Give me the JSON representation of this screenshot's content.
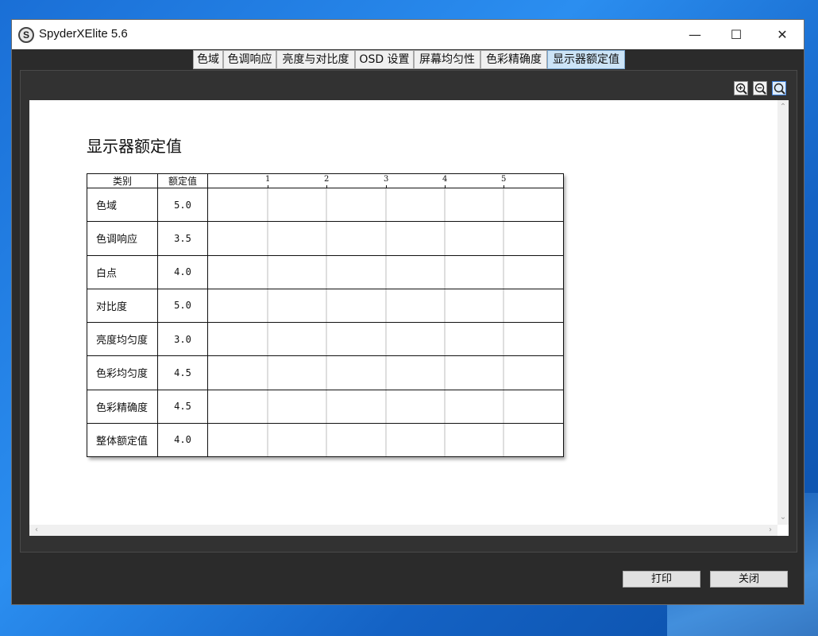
{
  "window": {
    "title": "SpyderXElite 5.6",
    "app_icon_letter": "S",
    "controls": {
      "minimize": "—",
      "maximize": "☐",
      "close": "✕"
    }
  },
  "tabs": [
    {
      "label": "色域",
      "active": false
    },
    {
      "label": "色调响应",
      "active": false
    },
    {
      "label": "亮度与对比度",
      "active": false
    },
    {
      "label": "OSD 设置",
      "active": false
    },
    {
      "label": "屏幕均匀性",
      "active": false
    },
    {
      "label": "色彩精确度",
      "active": false
    },
    {
      "label": "显示器额定值",
      "active": true
    }
  ],
  "zoom_tools": [
    {
      "name": "zoom-in-icon",
      "active": false
    },
    {
      "name": "zoom-out-icon",
      "active": false
    },
    {
      "name": "zoom-fit-icon",
      "active": true
    }
  ],
  "report": {
    "title": "显示器额定值",
    "columns": {
      "category": "类别",
      "rating": "额定值"
    },
    "scale": [
      "1",
      "2",
      "3",
      "4",
      "5"
    ],
    "rows": [
      {
        "category": "色域",
        "value_text": "5.0",
        "value": 5.0
      },
      {
        "category": "色调响应",
        "value_text": "3.5",
        "value": 3.5
      },
      {
        "category": "白点",
        "value_text": "4.0",
        "value": 4.0
      },
      {
        "category": "对比度",
        "value_text": "5.0",
        "value": 5.0
      },
      {
        "category": "亮度均匀度",
        "value_text": "3.0",
        "value": 3.0
      },
      {
        "category": "色彩均匀度",
        "value_text": "4.5",
        "value": 4.5
      },
      {
        "category": "色彩精确度",
        "value_text": "4.5",
        "value": 4.5
      },
      {
        "category": "整体额定值",
        "value_text": "4.0",
        "value": 4.0
      }
    ],
    "icon": "spyder-rating-icon"
  },
  "buttons": {
    "print": "打印",
    "close": "关闭"
  }
}
